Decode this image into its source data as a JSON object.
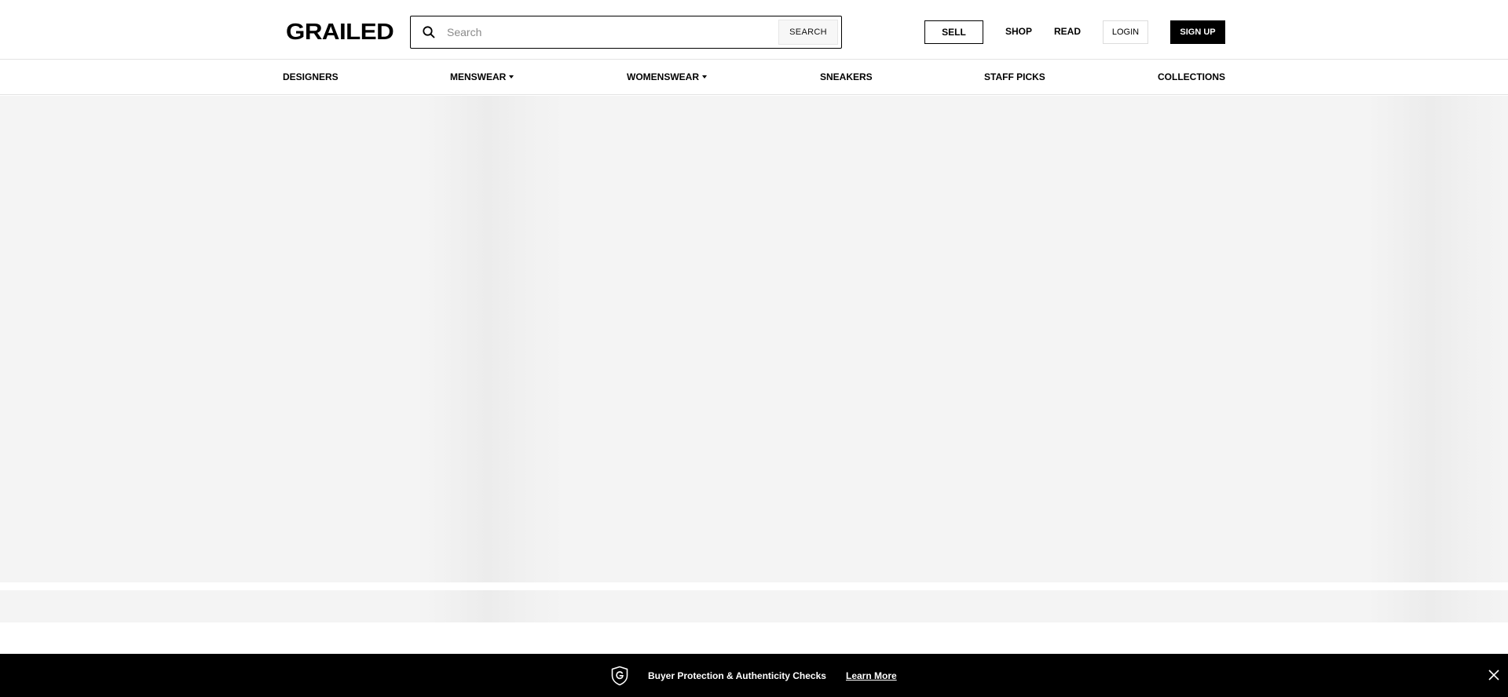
{
  "header": {
    "logo": "GRAILED",
    "search": {
      "placeholder": "Search",
      "value": "",
      "button_label": "SEARCH"
    },
    "sell_label": "SELL",
    "shop_label": "SHOP",
    "read_label": "READ",
    "login_label": "LOGIN",
    "signup_label": "SIGN UP"
  },
  "category_nav": {
    "items": [
      {
        "label": "DESIGNERS",
        "dropdown": false
      },
      {
        "label": "MENSWEAR",
        "dropdown": true
      },
      {
        "label": "WOMENSWEAR",
        "dropdown": true
      },
      {
        "label": "SNEAKERS",
        "dropdown": false
      },
      {
        "label": "STAFF PICKS",
        "dropdown": false
      },
      {
        "label": "COLLECTIONS",
        "dropdown": false
      }
    ]
  },
  "banner": {
    "icon": "shield-g-icon",
    "text": "Buyer Protection & Authenticity Checks",
    "link": "Learn More",
    "close_icon": "close-icon"
  },
  "colors": {
    "accent": "#000000",
    "background": "#ffffff",
    "placeholder_bg": "#f4f4f4"
  }
}
